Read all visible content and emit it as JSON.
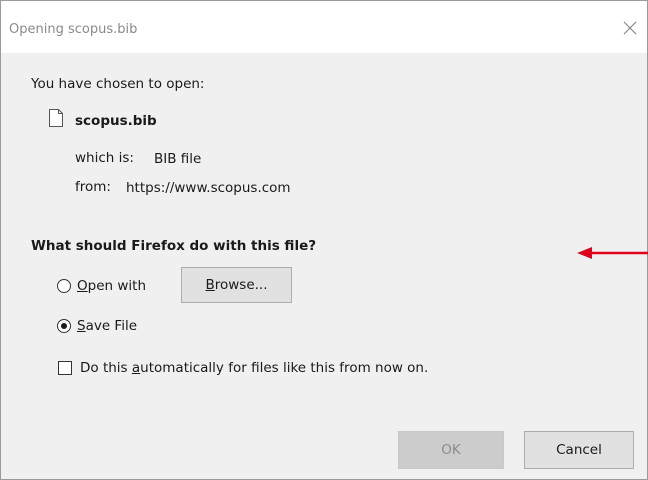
{
  "dialog": {
    "title": "Opening scopus.bib",
    "intro": "You have chosen to open:",
    "file_name": "scopus.bib",
    "type_label": "which is:",
    "type_value": "BIB file",
    "from_label": "from:",
    "from_value": "https://www.scopus.com",
    "question": "What should Firefox do with this file?"
  },
  "options": {
    "open_with": {
      "access_key": "O",
      "rest": "pen with",
      "selected": false
    },
    "browse_button": {
      "access_key": "B",
      "rest": "rowse..."
    },
    "save_file": {
      "access_key": "S",
      "rest": "ave File",
      "selected": true
    },
    "auto": {
      "before": "Do this ",
      "access_key": "a",
      "after": "utomatically for files like this from now on.",
      "checked": false
    }
  },
  "buttons": {
    "ok": "OK",
    "cancel": "Cancel"
  },
  "icons": {
    "close": "close-icon",
    "file": "file-icon",
    "annotation_arrow": "arrow-left-icon"
  },
  "colors": {
    "arrow": "#e0001b",
    "titlebar": "#ffffff",
    "body": "#f0f0f0"
  }
}
